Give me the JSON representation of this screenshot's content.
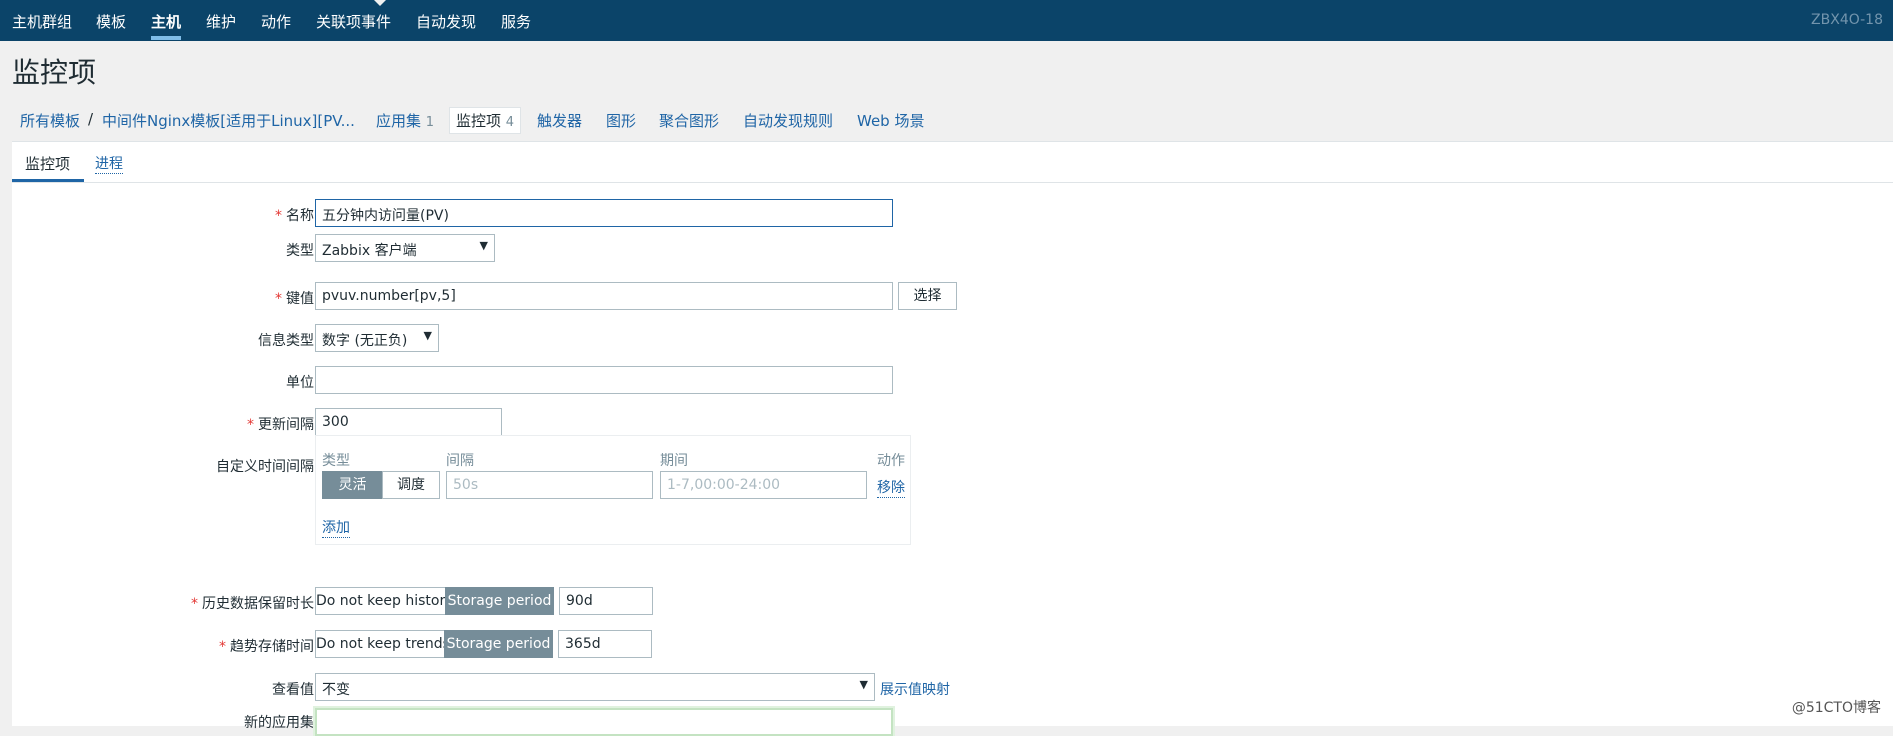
{
  "nav": {
    "items": [
      "主机群组",
      "模板",
      "主机",
      "维护",
      "动作",
      "关联项事件",
      "自动发现",
      "服务"
    ],
    "server_name": "ZBX4O-18"
  },
  "page_title": "监控项",
  "breadcrumb": {
    "all_templates": "所有模板",
    "separator": "/",
    "template": "中间件Nginx模板[适用于Linux][PV...",
    "applications": "应用集",
    "applications_count": "1",
    "items": "监控项",
    "items_count": "4",
    "triggers": "触发器",
    "graphs": "图形",
    "screens": "聚合图形",
    "discovery": "自动发现规则",
    "web": "Web 场景"
  },
  "tabs": [
    "监控项",
    "进程"
  ],
  "form": {
    "name_label": "名称",
    "name_value": "五分钟内访问量(PV)",
    "type_label": "类型",
    "type_value": "Zabbix 客户端",
    "key_label": "键值",
    "key_value": "pvuv.number[pv,5]",
    "select_button": "选择",
    "info_type_label": "信息类型",
    "info_type_value": "数字 (无正负)",
    "units_label": "单位",
    "units_value": "",
    "interval_label": "更新间隔",
    "interval_value": "300",
    "custom_intervals_label": "自定义时间间隔",
    "custom": {
      "col_type": "类型",
      "col_interval": "间隔",
      "col_period": "期间",
      "col_action": "动作",
      "flexible": "灵活",
      "scheduling": "调度",
      "interval_placeholder": "50s",
      "period_placeholder": "1-7,00:00-24:00",
      "remove": "移除",
      "add": "添加"
    },
    "history_label": "历史数据保留时长",
    "history_no_keep": "Do not keep history",
    "history_storage": "Storage period",
    "history_value": "90d",
    "trends_label": "趋势存储时间",
    "trends_no_keep": "Do not keep trends",
    "trends_storage": "Storage period",
    "trends_value": "365d",
    "valuemap_label": "查看值",
    "valuemap_value": "不变",
    "valuemap_link": "展示值映射",
    "new_app_label": "新的应用集",
    "new_app_value": ""
  },
  "watermark": "@51CTO博客"
}
